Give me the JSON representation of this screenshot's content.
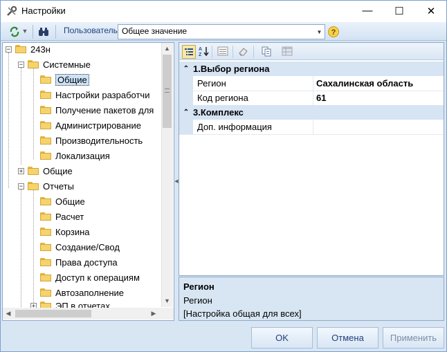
{
  "window": {
    "title": "Настройки",
    "controls": {
      "minimize": "—",
      "maximize": "☐",
      "close": "✕"
    }
  },
  "toolbar": {
    "user_label": "Пользователь",
    "user_value": "Общее значение"
  },
  "tree": {
    "items": [
      {
        "label": "243н"
      },
      {
        "label": "Системные"
      },
      {
        "label": "Общие"
      },
      {
        "label": "Настройки разработчи"
      },
      {
        "label": "Получение пакетов для"
      },
      {
        "label": "Администрирование"
      },
      {
        "label": "Производительность"
      },
      {
        "label": "Локализация"
      },
      {
        "label": "Общие"
      },
      {
        "label": "Отчеты"
      },
      {
        "label": "Общие"
      },
      {
        "label": "Расчет"
      },
      {
        "label": "Корзина"
      },
      {
        "label": "Создание/Свод"
      },
      {
        "label": "Права доступа"
      },
      {
        "label": "Доступ к операциям"
      },
      {
        "label": "Автозаполнение"
      },
      {
        "label": "ЭП в отчетах"
      }
    ],
    "selected_index": 2
  },
  "properties": {
    "categories": [
      {
        "label": "1.Выбор региона"
      },
      {
        "label": "3.Комплекс"
      }
    ],
    "rows": [
      {
        "name": "Регион",
        "value": "Сахалинская область"
      },
      {
        "name": "Код региона",
        "value": "61"
      },
      {
        "name": "Доп. информация",
        "value": ""
      }
    ]
  },
  "description": {
    "title": "Регион",
    "line1": "Регион",
    "line2": "[Настройка общая для всех]"
  },
  "buttons": {
    "ok": "OK",
    "cancel": "Отмена",
    "apply": "Применить"
  },
  "colors": {
    "accent": "#1e3f7a",
    "panel_bg": "#d8e6f4",
    "category_bg": "#d6e4f3"
  }
}
